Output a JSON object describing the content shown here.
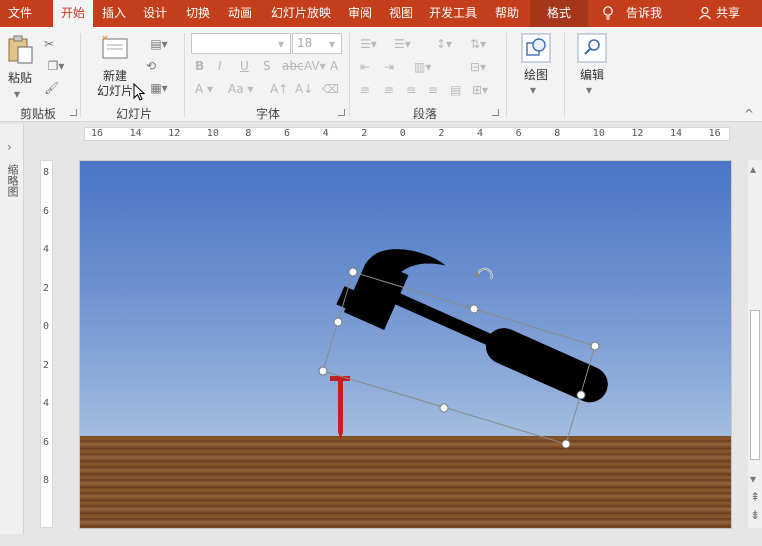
{
  "tabs": [
    {
      "label": "文件"
    },
    {
      "label": "开始"
    },
    {
      "label": "插入"
    },
    {
      "label": "设计"
    },
    {
      "label": "切换"
    },
    {
      "label": "动画"
    },
    {
      "label": "幻灯片放映"
    },
    {
      "label": "审阅"
    },
    {
      "label": "视图"
    },
    {
      "label": "开发工具"
    },
    {
      "label": "帮助"
    },
    {
      "label": "格式"
    }
  ],
  "tell_me": "告诉我",
  "share": "共享",
  "clipboard": {
    "paste": "粘贴",
    "group_label": "剪贴板"
  },
  "slides": {
    "new_slide_line1": "新建",
    "new_slide_line2": "幻灯片",
    "group_label": "幻灯片"
  },
  "font": {
    "name_value": "",
    "size_value": "18",
    "group_label": "字体"
  },
  "paragraph": {
    "group_label": "段落"
  },
  "drawing": {
    "label": "绘图"
  },
  "editing": {
    "label": "编辑"
  },
  "thumbnail_pane": "缩略图",
  "hruler_labels": [
    "16",
    "14",
    "12",
    "10",
    "8",
    "6",
    "4",
    "2",
    "0",
    "2",
    "4",
    "6",
    "8",
    "10",
    "12",
    "14",
    "16"
  ],
  "vruler_labels": [
    "8",
    "6",
    "4",
    "2",
    "0",
    "2",
    "4",
    "6",
    "8"
  ],
  "colors": {
    "accent": "#c43e1c",
    "ribbon": "#f3f3f3",
    "sky_top": "#4a76c8",
    "sky_bottom": "#a8bfe0",
    "nail": "#c81d1d"
  }
}
